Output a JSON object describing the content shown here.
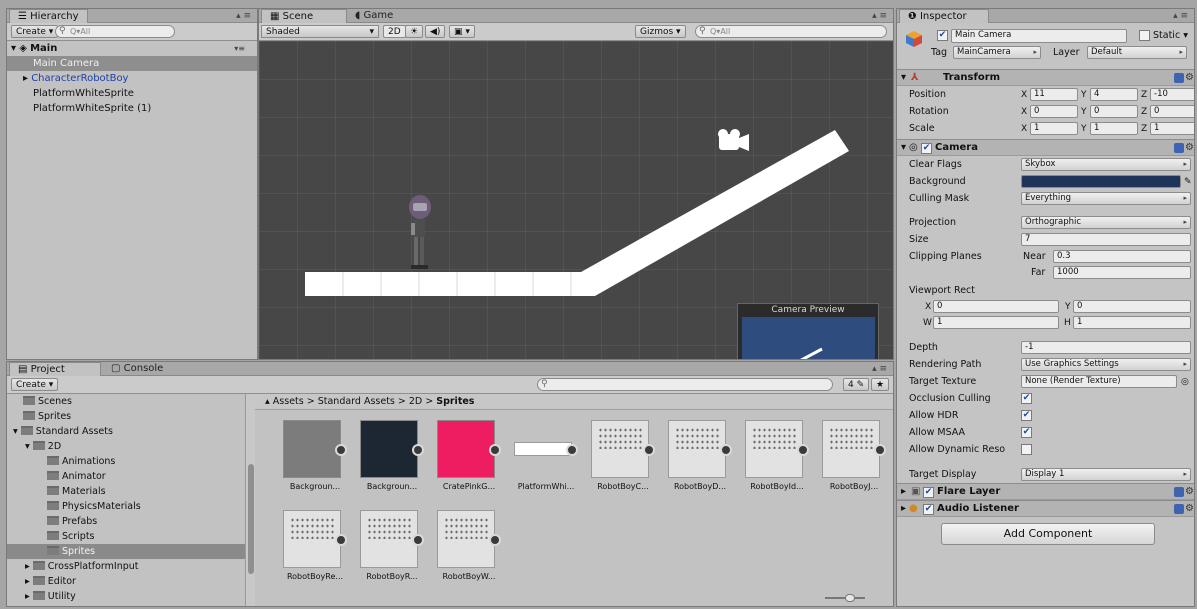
{
  "hierarchy": {
    "tab": "Hierarchy",
    "create": "Create",
    "search_placeholder": "Q▾All",
    "scene_name": "Main",
    "items": [
      {
        "label": "Main Camera"
      },
      {
        "label": "CharacterRobotBoy"
      },
      {
        "label": "PlatformWhiteSprite"
      },
      {
        "label": "PlatformWhiteSprite (1)"
      }
    ]
  },
  "scene": {
    "tabs": [
      "Scene",
      "Game"
    ],
    "shading": "Shaded",
    "mode_2d": "2D",
    "gizmos": "Gizmos",
    "search_placeholder": "Q▾All",
    "camera_preview_label": "Camera Preview"
  },
  "project": {
    "tabs": [
      "Project",
      "Console"
    ],
    "create": "Create",
    "filter_count": "4",
    "folders": [
      {
        "label": "Scenes",
        "indent": 1
      },
      {
        "label": "Sprites",
        "indent": 1
      },
      {
        "label": "Standard Assets",
        "indent": 1
      },
      {
        "label": "2D",
        "indent": 2
      },
      {
        "label": "Animations",
        "indent": 3
      },
      {
        "label": "Animator",
        "indent": 3
      },
      {
        "label": "Materials",
        "indent": 3
      },
      {
        "label": "PhysicsMaterials",
        "indent": 3
      },
      {
        "label": "Prefabs",
        "indent": 3
      },
      {
        "label": "Scripts",
        "indent": 3
      },
      {
        "label": "Sprites",
        "indent": 3
      },
      {
        "label": "CrossPlatformInput",
        "indent": 2
      },
      {
        "label": "Editor",
        "indent": 2
      },
      {
        "label": "Utility",
        "indent": 2
      }
    ],
    "breadcrumb": [
      "Assets",
      "Standard Assets",
      "2D",
      "Sprites"
    ],
    "assets": [
      {
        "name": "Backgroun...",
        "kind": "grey"
      },
      {
        "name": "Backgroun...",
        "kind": "dark"
      },
      {
        "name": "CratePinkG...",
        "kind": "pink"
      },
      {
        "name": "PlatformWhi...",
        "kind": "white"
      },
      {
        "name": "RobotBoyC...",
        "kind": "sheet"
      },
      {
        "name": "RobotBoyD...",
        "kind": "sheet"
      },
      {
        "name": "RobotBoyId...",
        "kind": "sheet"
      },
      {
        "name": "RobotBoyJ...",
        "kind": "sheet"
      },
      {
        "name": "RobotBoyRe...",
        "kind": "sheet"
      },
      {
        "name": "RobotBoyR...",
        "kind": "sheet"
      },
      {
        "name": "RobotBoyW...",
        "kind": "sheet"
      }
    ]
  },
  "inspector": {
    "tab": "Inspector",
    "object_name": "Main Camera",
    "static_label": "Static",
    "tag_label": "Tag",
    "tag_value": "MainCamera",
    "layer_label": "Layer",
    "layer_value": "Default",
    "transform": {
      "title": "Transform",
      "position": {
        "label": "Position",
        "x": "11",
        "y": "4",
        "z": "-10"
      },
      "rotation": {
        "label": "Rotation",
        "x": "0",
        "y": "0",
        "z": "0"
      },
      "scale": {
        "label": "Scale",
        "x": "1",
        "y": "1",
        "z": "1"
      }
    },
    "camera": {
      "title": "Camera",
      "clear_flags_label": "Clear Flags",
      "clear_flags": "Skybox",
      "background_label": "Background",
      "background_color": "#1f3458",
      "culling_mask_label": "Culling Mask",
      "culling_mask": "Everything",
      "projection_label": "Projection",
      "projection": "Orthographic",
      "size_label": "Size",
      "size": "7",
      "clipping_label": "Clipping Planes",
      "near_label": "Near",
      "near": "0.3",
      "far_label": "Far",
      "far": "1000",
      "viewport_label": "Viewport Rect",
      "vx": "0",
      "vy": "0",
      "vw": "1",
      "vh": "1",
      "depth_label": "Depth",
      "depth": "-1",
      "rendering_path_label": "Rendering Path",
      "rendering_path": "Use Graphics Settings",
      "target_texture_label": "Target Texture",
      "target_texture": "None (Render Texture)",
      "occlusion_label": "Occlusion Culling",
      "occlusion": true,
      "hdr_label": "Allow HDR",
      "hdr": true,
      "msaa_label": "Allow MSAA",
      "msaa": true,
      "dynres_label": "Allow Dynamic Reso",
      "dynres": false,
      "target_display_label": "Target Display",
      "target_display": "Display 1"
    },
    "flare_layer": "Flare Layer",
    "audio_listener": "Audio Listener",
    "add_component": "Add Component"
  }
}
